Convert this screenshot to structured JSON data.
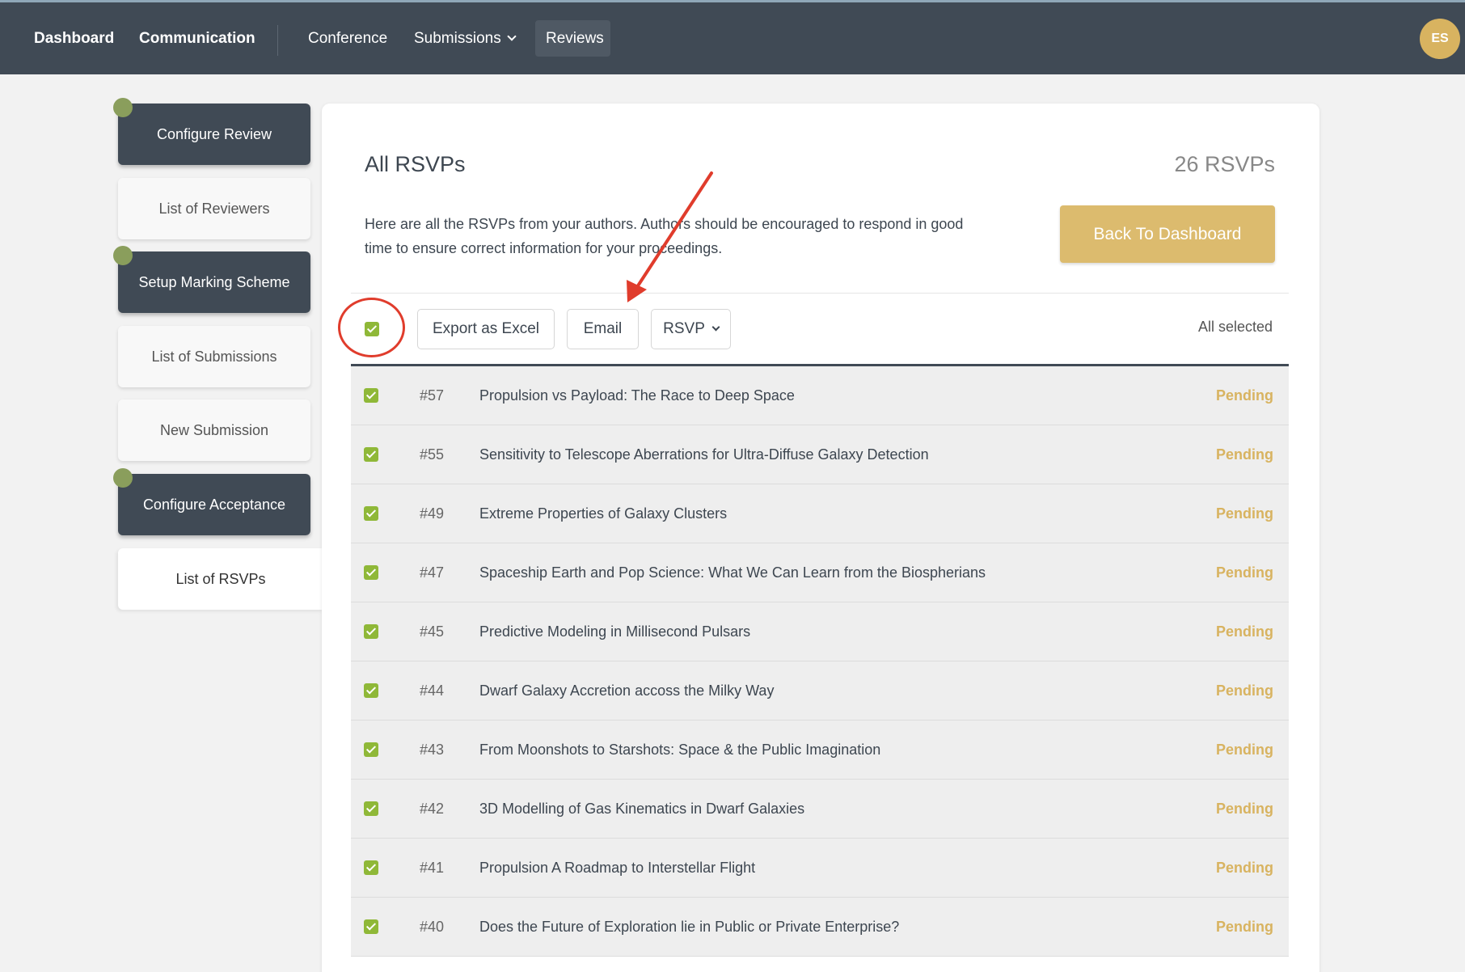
{
  "nav": {
    "dashboard": "Dashboard",
    "communication": "Communication",
    "conference": "Conference",
    "submissions": "Submissions",
    "reviews": "Reviews",
    "avatar_initials": "ES"
  },
  "sidebar": {
    "items": [
      {
        "label": "Configure Review",
        "style": "dark",
        "dot": true
      },
      {
        "label": "List of Reviewers",
        "style": "light",
        "dot": false
      },
      {
        "label": "Setup Marking Scheme",
        "style": "dark",
        "dot": true
      },
      {
        "label": "List of Submissions",
        "style": "light",
        "dot": false
      },
      {
        "label": "New Submission",
        "style": "light",
        "dot": false
      },
      {
        "label": "Configure Acceptance",
        "style": "dark",
        "dot": true
      },
      {
        "label": "List of RSVPs",
        "style": "active",
        "dot": false
      }
    ]
  },
  "main": {
    "title": "All RSVPs",
    "count": "26 RSVPs",
    "description": "Here are all the RSVPs from your authors. Authors should be encouraged to respond in good time to ensure correct information for your proceedings.",
    "back_button": "Back To Dashboard",
    "toolbar": {
      "export_label": "Export as Excel",
      "email_label": "Email",
      "rsvp_label": "RSVP",
      "selection_status": "All selected"
    },
    "rows": [
      {
        "id": "#57",
        "title": "Propulsion vs Payload: The Race to Deep Space",
        "status": "Pending"
      },
      {
        "id": "#55",
        "title": "Sensitivity to Telescope Aberrations for Ultra-Diffuse Galaxy Detection",
        "status": "Pending"
      },
      {
        "id": "#49",
        "title": "Extreme Properties of Galaxy Clusters",
        "status": "Pending"
      },
      {
        "id": "#47",
        "title": "Spaceship Earth and Pop Science: What We Can Learn from the Biospherians",
        "status": "Pending"
      },
      {
        "id": "#45",
        "title": "Predictive Modeling in Millisecond Pulsars",
        "status": "Pending"
      },
      {
        "id": "#44",
        "title": "Dwarf Galaxy Accretion accoss the Milky Way",
        "status": "Pending"
      },
      {
        "id": "#43",
        "title": "From Moonshots to Starshots: Space & the Public Imagination",
        "status": "Pending"
      },
      {
        "id": "#42",
        "title": "3D Modelling of Gas Kinematics in Dwarf Galaxies",
        "status": "Pending"
      },
      {
        "id": "#41",
        "title": "Propulsion A Roadmap to Interstellar Flight",
        "status": "Pending"
      },
      {
        "id": "#40",
        "title": "Does the Future of Exploration lie in Public or Private Enterprise?",
        "status": "Pending"
      }
    ]
  },
  "colors": {
    "nav_bg": "#404a55",
    "accent_gold": "#d8b360",
    "check_green": "#8fb838",
    "annotation_red": "#e03c2c"
  }
}
